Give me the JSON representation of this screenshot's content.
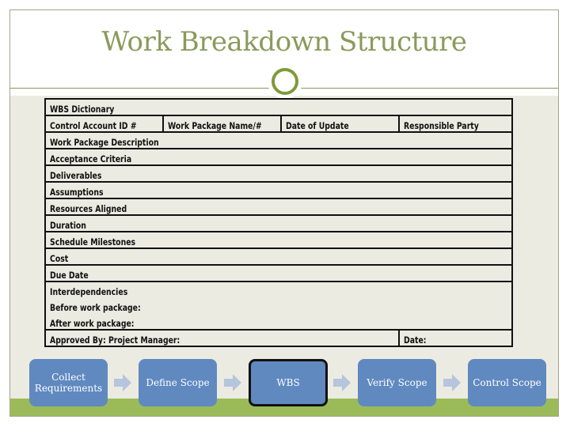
{
  "slide": {
    "title": "Work Breakdown Structure",
    "colors": {
      "title": "#8a9a5b",
      "accent_ring": "#7f9a3a",
      "band": "#9bbb59",
      "step_fill": "#6089c0",
      "arrow": "#b4c5dc",
      "background": "#ecebe2"
    }
  },
  "table": {
    "header": "WBS Dictionary",
    "columns": [
      "Control Account ID #",
      "Work Package Name/#",
      "Date of Update",
      "Responsible Party"
    ],
    "rows": [
      "Work Package Description",
      "Acceptance Criteria",
      "Deliverables",
      "Assumptions",
      "Resources Aligned",
      "Duration",
      "Schedule Milestones",
      "Cost",
      "Due Date"
    ],
    "interdependencies": {
      "label": "Interdependencies",
      "before": "Before work package:",
      "after": "After work package:"
    },
    "approval": {
      "approved_by": "Approved By: Project Manager:",
      "date": "Date:"
    }
  },
  "process_flow": {
    "steps": [
      {
        "label": "Collect Requirements",
        "active": false
      },
      {
        "label": "Define Scope",
        "active": false
      },
      {
        "label": "WBS",
        "active": true
      },
      {
        "label": "Verify Scope",
        "active": false
      },
      {
        "label": "Control Scope",
        "active": false
      }
    ],
    "arrow_icon": "right-arrow-icon"
  }
}
